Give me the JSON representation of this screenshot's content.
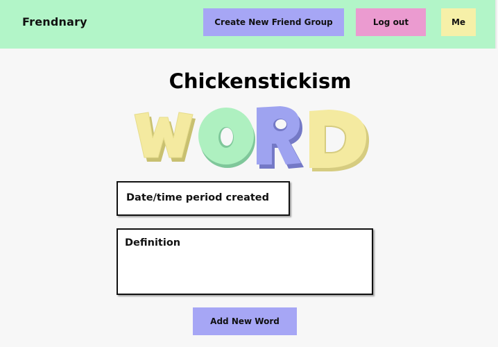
{
  "navbar": {
    "brand": "Frendnary",
    "create_group_label": "Create New Friend Group",
    "logout_label": "Log out",
    "me_label": "Me"
  },
  "main": {
    "title": "Chickenstickism",
    "word_art": {
      "letters": [
        "W",
        "O",
        "R",
        "D"
      ],
      "colors": [
        "#f4eaa0",
        "#aef0c0",
        "#9ea3f0",
        "#f4eaa0"
      ]
    },
    "date_field_label": "Date/time period created",
    "definition_label": "Definition",
    "add_word_label": "Add New Word"
  },
  "colors": {
    "navbar_bg": "#b2f5c8",
    "create_button": "#a6a6f5",
    "logout_button": "#eb9bd0",
    "me_button": "#f6f0a8",
    "add_button": "#a6a6f5"
  }
}
